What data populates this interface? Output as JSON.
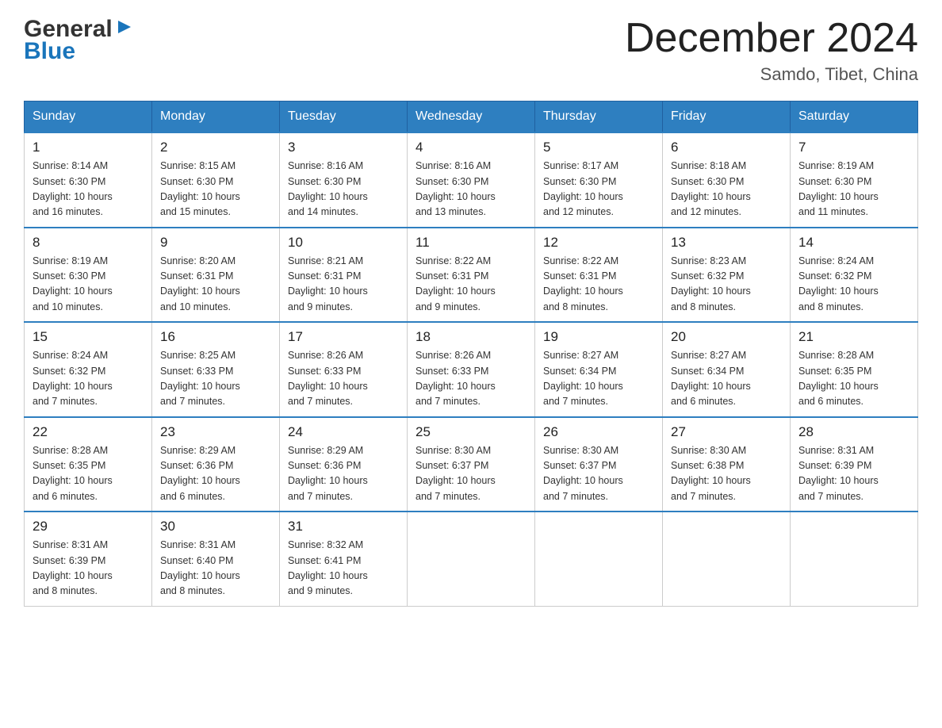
{
  "header": {
    "logo_general": "General",
    "logo_blue": "Blue",
    "month_title": "December 2024",
    "location": "Samdo, Tibet, China"
  },
  "days_of_week": [
    "Sunday",
    "Monday",
    "Tuesday",
    "Wednesday",
    "Thursday",
    "Friday",
    "Saturday"
  ],
  "weeks": [
    [
      {
        "day": "1",
        "sunrise": "8:14 AM",
        "sunset": "6:30 PM",
        "daylight": "10 hours and 16 minutes."
      },
      {
        "day": "2",
        "sunrise": "8:15 AM",
        "sunset": "6:30 PM",
        "daylight": "10 hours and 15 minutes."
      },
      {
        "day": "3",
        "sunrise": "8:16 AM",
        "sunset": "6:30 PM",
        "daylight": "10 hours and 14 minutes."
      },
      {
        "day": "4",
        "sunrise": "8:16 AM",
        "sunset": "6:30 PM",
        "daylight": "10 hours and 13 minutes."
      },
      {
        "day": "5",
        "sunrise": "8:17 AM",
        "sunset": "6:30 PM",
        "daylight": "10 hours and 12 minutes."
      },
      {
        "day": "6",
        "sunrise": "8:18 AM",
        "sunset": "6:30 PM",
        "daylight": "10 hours and 12 minutes."
      },
      {
        "day": "7",
        "sunrise": "8:19 AM",
        "sunset": "6:30 PM",
        "daylight": "10 hours and 11 minutes."
      }
    ],
    [
      {
        "day": "8",
        "sunrise": "8:19 AM",
        "sunset": "6:30 PM",
        "daylight": "10 hours and 10 minutes."
      },
      {
        "day": "9",
        "sunrise": "8:20 AM",
        "sunset": "6:31 PM",
        "daylight": "10 hours and 10 minutes."
      },
      {
        "day": "10",
        "sunrise": "8:21 AM",
        "sunset": "6:31 PM",
        "daylight": "10 hours and 9 minutes."
      },
      {
        "day": "11",
        "sunrise": "8:22 AM",
        "sunset": "6:31 PM",
        "daylight": "10 hours and 9 minutes."
      },
      {
        "day": "12",
        "sunrise": "8:22 AM",
        "sunset": "6:31 PM",
        "daylight": "10 hours and 8 minutes."
      },
      {
        "day": "13",
        "sunrise": "8:23 AM",
        "sunset": "6:32 PM",
        "daylight": "10 hours and 8 minutes."
      },
      {
        "day": "14",
        "sunrise": "8:24 AM",
        "sunset": "6:32 PM",
        "daylight": "10 hours and 8 minutes."
      }
    ],
    [
      {
        "day": "15",
        "sunrise": "8:24 AM",
        "sunset": "6:32 PM",
        "daylight": "10 hours and 7 minutes."
      },
      {
        "day": "16",
        "sunrise": "8:25 AM",
        "sunset": "6:33 PM",
        "daylight": "10 hours and 7 minutes."
      },
      {
        "day": "17",
        "sunrise": "8:26 AM",
        "sunset": "6:33 PM",
        "daylight": "10 hours and 7 minutes."
      },
      {
        "day": "18",
        "sunrise": "8:26 AM",
        "sunset": "6:33 PM",
        "daylight": "10 hours and 7 minutes."
      },
      {
        "day": "19",
        "sunrise": "8:27 AM",
        "sunset": "6:34 PM",
        "daylight": "10 hours and 7 minutes."
      },
      {
        "day": "20",
        "sunrise": "8:27 AM",
        "sunset": "6:34 PM",
        "daylight": "10 hours and 6 minutes."
      },
      {
        "day": "21",
        "sunrise": "8:28 AM",
        "sunset": "6:35 PM",
        "daylight": "10 hours and 6 minutes."
      }
    ],
    [
      {
        "day": "22",
        "sunrise": "8:28 AM",
        "sunset": "6:35 PM",
        "daylight": "10 hours and 6 minutes."
      },
      {
        "day": "23",
        "sunrise": "8:29 AM",
        "sunset": "6:36 PM",
        "daylight": "10 hours and 6 minutes."
      },
      {
        "day": "24",
        "sunrise": "8:29 AM",
        "sunset": "6:36 PM",
        "daylight": "10 hours and 7 minutes."
      },
      {
        "day": "25",
        "sunrise": "8:30 AM",
        "sunset": "6:37 PM",
        "daylight": "10 hours and 7 minutes."
      },
      {
        "day": "26",
        "sunrise": "8:30 AM",
        "sunset": "6:37 PM",
        "daylight": "10 hours and 7 minutes."
      },
      {
        "day": "27",
        "sunrise": "8:30 AM",
        "sunset": "6:38 PM",
        "daylight": "10 hours and 7 minutes."
      },
      {
        "day": "28",
        "sunrise": "8:31 AM",
        "sunset": "6:39 PM",
        "daylight": "10 hours and 7 minutes."
      }
    ],
    [
      {
        "day": "29",
        "sunrise": "8:31 AM",
        "sunset": "6:39 PM",
        "daylight": "10 hours and 8 minutes."
      },
      {
        "day": "30",
        "sunrise": "8:31 AM",
        "sunset": "6:40 PM",
        "daylight": "10 hours and 8 minutes."
      },
      {
        "day": "31",
        "sunrise": "8:32 AM",
        "sunset": "6:41 PM",
        "daylight": "10 hours and 9 minutes."
      },
      null,
      null,
      null,
      null
    ]
  ]
}
